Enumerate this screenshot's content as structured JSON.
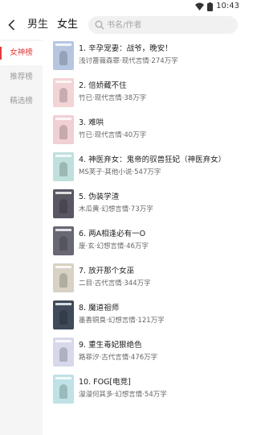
{
  "status_bar": {
    "time": "10:43",
    "icons": [
      "wifi-icon",
      "battery-icon"
    ]
  },
  "header": {
    "back_icon": "chevron-left-icon",
    "tabs": [
      {
        "label": "男生",
        "active": false
      },
      {
        "label": "女生",
        "active": true
      }
    ],
    "search": {
      "placeholder": "书名/作者",
      "icon": "search-icon"
    }
  },
  "sidebar": {
    "items": [
      {
        "label": "女神榜",
        "active": true
      },
      {
        "label": "推荐榜",
        "active": false
      },
      {
        "label": "精选榜",
        "active": false
      }
    ],
    "accent": "#e23b3b"
  },
  "books": [
    {
      "title": "1. 辛孕宠妻：战爷，晚安！",
      "meta": "浅讨蔷薇森罪·现代言情·274万字",
      "cover_color": "#b7c6e0"
    },
    {
      "title": "2. 倍娇藏不住",
      "meta": "竹已·现代言情·38万字",
      "cover_color": "#f3d3d6"
    },
    {
      "title": "3. 难哄",
      "meta": "竹已·现代言情·40万字",
      "cover_color": "#f0d0d4"
    },
    {
      "title": "4. 神医弃女：鬼帝的驭兽狂妃（神医弃女）",
      "meta": "MS芙子·其他小说·547万字",
      "cover_color": "#bfe0dc"
    },
    {
      "title": "5. 伪装学渣",
      "meta": "木瓜黄·幻想言情·73万字",
      "cover_color": "#5a5662"
    },
    {
      "title": "6. 两A相逢必有一O",
      "meta": "废·玄·幻想言情·46万字",
      "cover_color": "#686874"
    },
    {
      "title": "7. 放开那个女巫",
      "meta": "二目·古代言情·344万字",
      "cover_color": "#d8d2c4"
    },
    {
      "title": "8. 魔道祖师",
      "meta": "墨香铜臭·幻想言情·121万字",
      "cover_color": "#3f4a5a"
    },
    {
      "title": "9. 重生毒妃狠绝色",
      "meta": "路菲汐·古代言情·476万字",
      "cover_color": "#d7d8ea"
    },
    {
      "title": "10. FOG[电竞]",
      "meta": "漫漫何其多·幻想言情·54万字",
      "cover_color": "#bfe2e6"
    }
  ]
}
